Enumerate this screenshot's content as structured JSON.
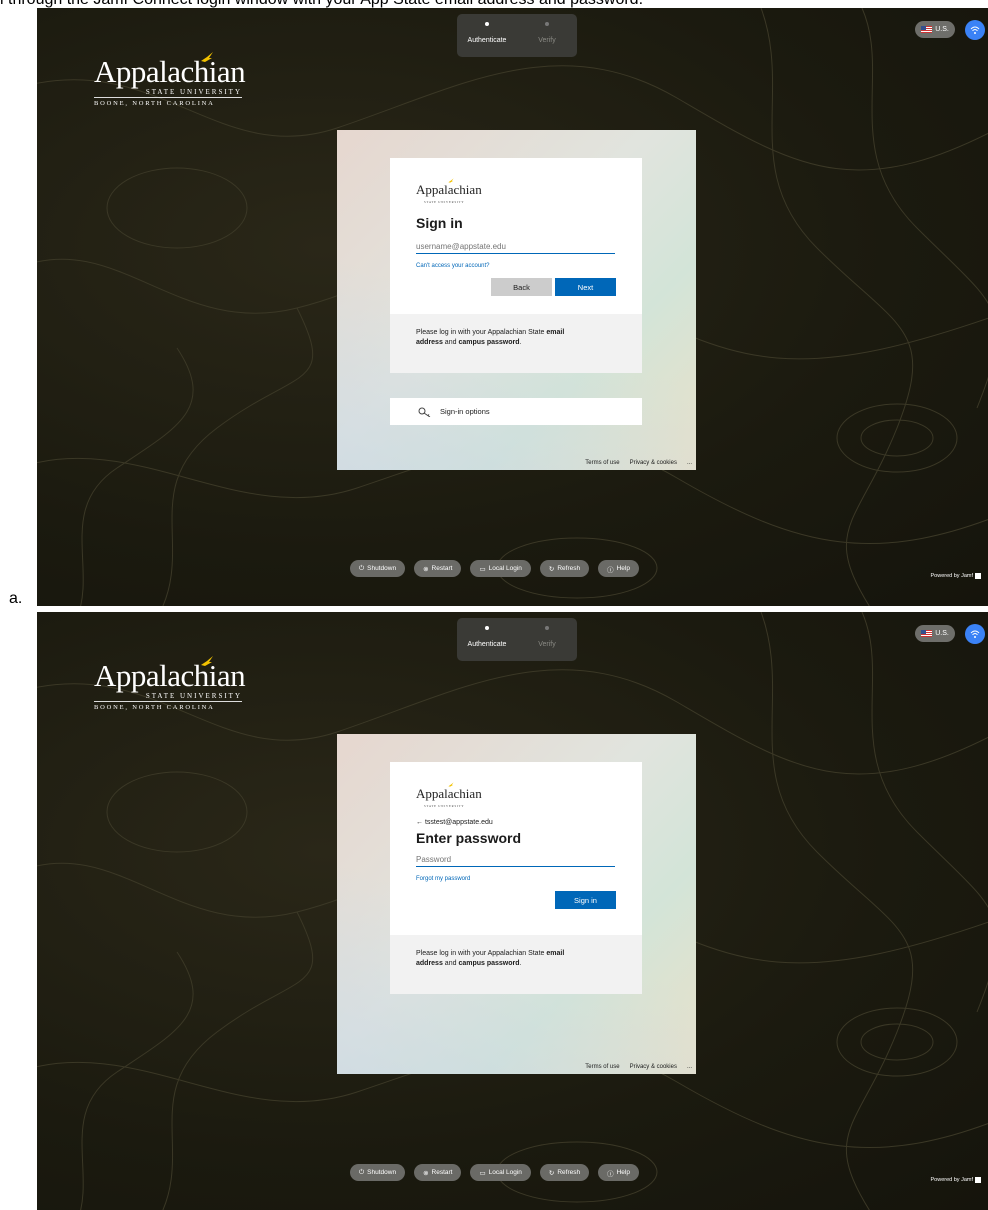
{
  "caption": "l through the Jamf Connect login window with your App State email address and password.",
  "screens": [
    {
      "letter": "a.",
      "steps": [
        "Authenticate",
        "Verify"
      ],
      "lang": "U.S.",
      "logo": {
        "name": "Appalachian",
        "line1": "STATE UNIVERSITY",
        "line2": "BOONE, NORTH CAROLINA"
      },
      "card": {
        "logo_name": "Appalachian",
        "logo_sub": "STATE UNIVERSITY",
        "identity": "",
        "title": "Sign in",
        "field_placeholder": "username@appstate.edu",
        "link": "Can't access your account?",
        "back": "Back",
        "primary": "Next",
        "notice_1": "Please log in with your Appalachian State ",
        "notice_b1": "email",
        "notice_b2": "address",
        "notice_2": " and ",
        "notice_b3": "campus password",
        "notice_3": "."
      },
      "signin_options": "Sign-in options",
      "footer": {
        "terms": "Terms of use",
        "privacy": "Privacy & cookies",
        "more": "..."
      },
      "bottom_buttons": [
        "Shutdown",
        "Restart",
        "Local Login",
        "Refresh",
        "Help"
      ],
      "powered": "Powered by Jamf"
    },
    {
      "letter": "",
      "steps": [
        "Authenticate",
        "Verify"
      ],
      "lang": "U.S.",
      "logo": {
        "name": "Appalachian",
        "line1": "STATE UNIVERSITY",
        "line2": "BOONE, NORTH CAROLINA"
      },
      "card": {
        "logo_name": "Appalachian",
        "logo_sub": "STATE UNIVERSITY",
        "identity": "tsstest@appstate.edu",
        "title": "Enter password",
        "field_placeholder": "Password",
        "link": "Forgot my password",
        "back": "",
        "primary": "Sign in",
        "notice_1": "Please log in with your Appalachian State ",
        "notice_b1": "email",
        "notice_b2": "address",
        "notice_2": " and ",
        "notice_b3": "campus password",
        "notice_3": "."
      },
      "signin_options": "",
      "footer": {
        "terms": "Terms of use",
        "privacy": "Privacy & cookies",
        "more": "..."
      },
      "bottom_buttons": [
        "Shutdown",
        "Restart",
        "Local Login",
        "Refresh",
        "Help"
      ],
      "powered": "Powered by Jamf"
    }
  ],
  "icons": {
    "shutdown": "power-icon",
    "restart": "restart-icon",
    "local": "laptop-icon",
    "refresh": "refresh-icon",
    "help": "help-icon",
    "key": "key-icon",
    "wifi": "wifi-icon",
    "back_arrow": "arrow-left-icon"
  },
  "colors": {
    "accent": "#0067b8",
    "background": "#1b1a0f",
    "bird": "#f2c200"
  }
}
